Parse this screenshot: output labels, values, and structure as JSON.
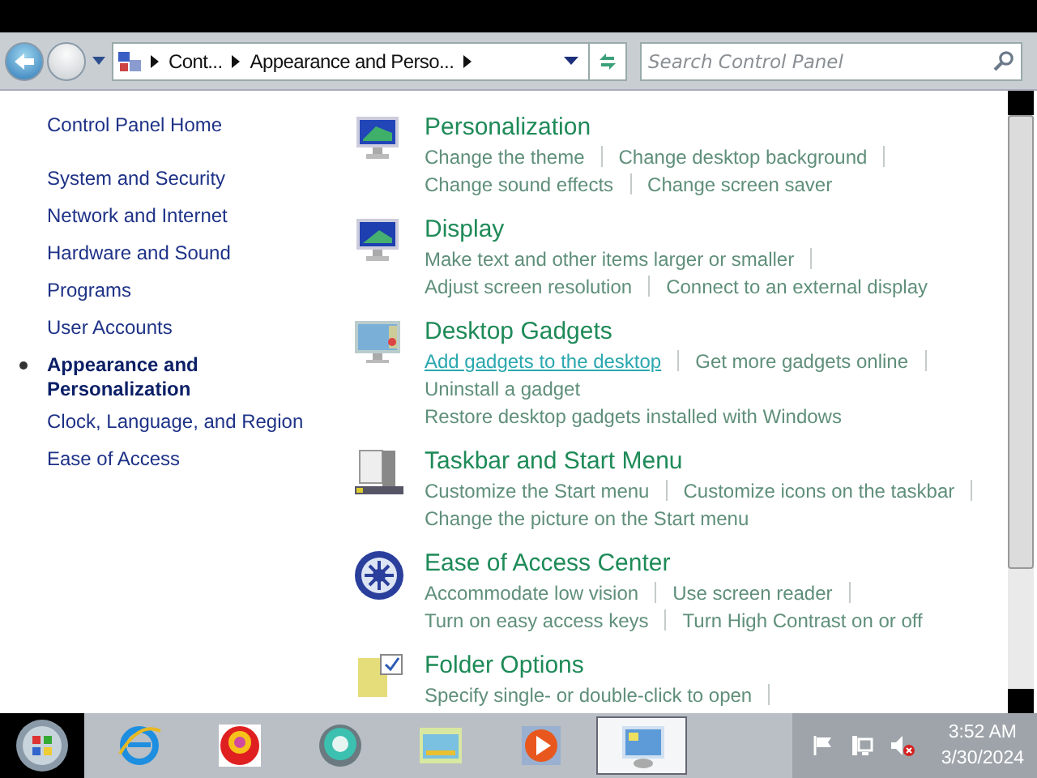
{
  "navigation": {
    "back_disabled": false,
    "forward_disabled": true,
    "breadcrumb": [
      "Cont...",
      "Appearance and Perso..."
    ],
    "search": {
      "placeholder": "Search Control Panel"
    }
  },
  "sidebar": {
    "items": [
      {
        "label": "Control Panel Home",
        "selected": false
      },
      {
        "label": "System and Security",
        "selected": false
      },
      {
        "label": "Network and Internet",
        "selected": false
      },
      {
        "label": "Hardware and Sound",
        "selected": false
      },
      {
        "label": "Programs",
        "selected": false
      },
      {
        "label": "User Accounts",
        "selected": false
      },
      {
        "label": "Appearance and Personalization",
        "selected": true
      },
      {
        "label": "Clock, Language, and Region",
        "selected": false
      },
      {
        "label": "Ease of Access",
        "selected": false
      }
    ]
  },
  "sections": [
    {
      "title": "Personalization",
      "lines": [
        [
          {
            "label": "Change the theme",
            "hovered": false
          },
          {
            "label": "Change desktop background",
            "hovered": false
          }
        ],
        [
          {
            "label": "Change sound effects",
            "hovered": false
          },
          {
            "label": "Change screen saver",
            "hovered": false
          }
        ]
      ]
    },
    {
      "title": "Display",
      "lines": [
        [
          {
            "label": "Make text and other items larger or smaller",
            "hovered": false
          }
        ],
        [
          {
            "label": "Adjust screen resolution",
            "hovered": false
          },
          {
            "label": "Connect to an external display",
            "hovered": false
          }
        ]
      ]
    },
    {
      "title": "Desktop Gadgets",
      "lines": [
        [
          {
            "label": "Add gadgets to the desktop",
            "hovered": true
          },
          {
            "label": "Get more gadgets online",
            "hovered": false
          }
        ],
        [
          {
            "label": "Uninstall a gadget",
            "hovered": false
          }
        ],
        [
          {
            "label": "Restore desktop gadgets installed with Windows",
            "hovered": false
          }
        ]
      ]
    },
    {
      "title": "Taskbar and Start Menu",
      "lines": [
        [
          {
            "label": "Customize the Start menu",
            "hovered": false
          },
          {
            "label": "Customize icons on the taskbar",
            "hovered": false
          }
        ],
        [
          {
            "label": "Change the picture on the Start menu",
            "hovered": false
          }
        ]
      ]
    },
    {
      "title": "Ease of Access Center",
      "lines": [
        [
          {
            "label": "Accommodate low vision",
            "hovered": false
          },
          {
            "label": "Use screen reader",
            "hovered": false
          }
        ],
        [
          {
            "label": "Turn on easy access keys",
            "hovered": false
          },
          {
            "label": "Turn High Contrast on or off",
            "hovered": false
          }
        ]
      ]
    },
    {
      "title": "Folder Options",
      "lines": [
        [
          {
            "label": "Specify single- or double-click to open",
            "hovered": false
          }
        ]
      ]
    }
  ],
  "taskbar": {
    "apps": [
      {
        "selected": false
      },
      {
        "selected": false
      },
      {
        "selected": false
      },
      {
        "selected": false
      },
      {
        "selected": false
      },
      {
        "selected": true
      }
    ],
    "time": "3:52 AM",
    "date": "3/30/2024",
    "volume_muted": true
  }
}
